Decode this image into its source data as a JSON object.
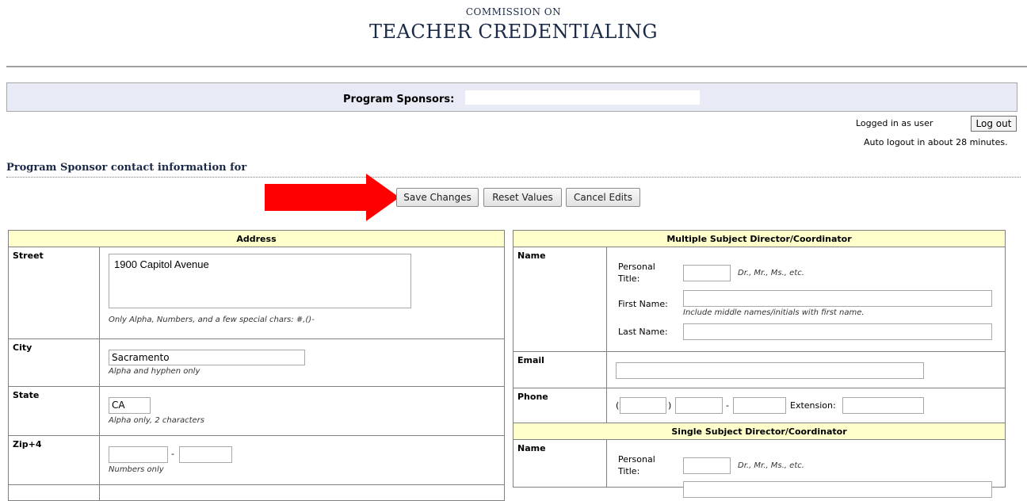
{
  "header": {
    "logo_line1": "COMMISSION ON",
    "logo_line2": "TEACHER CREDENTIALING"
  },
  "sponsor_bar": {
    "label": "Program Sponsors:",
    "value": ""
  },
  "session": {
    "logged_in": "Logged in as user",
    "logout": "Log out",
    "auto_logout": "Auto logout in about 28 minutes."
  },
  "section_title": "Program Sponsor contact information for",
  "actions": {
    "save": "Save Changes",
    "reset": "Reset Values",
    "cancel": "Cancel Edits"
  },
  "address": {
    "header": "Address",
    "street_label": "Street",
    "street_value": "1900 Capitol Avenue",
    "street_hint": "Only Alpha, Numbers, and a few special chars: #,()-",
    "city_label": "City",
    "city_value": "Sacramento",
    "city_hint": "Alpha and hyphen only",
    "state_label": "State",
    "state_value": "CA",
    "state_hint": "Alpha only, 2 characters",
    "zip_label": "Zip+4",
    "zip_dash": "-",
    "zip_hint": "Numbers only"
  },
  "multiple_subject": {
    "header": "Multiple Subject Director/Coordinator",
    "name_label": "Name",
    "personal_title": "Personal Title:",
    "title_hint": "Dr., Mr., Ms., etc.",
    "first_name": "First Name:",
    "first_hint": "Include middle names/initials with first name.",
    "last_name": "Last Name:",
    "email_label": "Email",
    "phone_label": "Phone",
    "paren_open": "(",
    "paren_close": ")",
    "dash": "-",
    "extension": "Extension:"
  },
  "single_subject": {
    "header": "Single Subject Director/Coordinator",
    "name_label": "Name",
    "personal_title": "Personal Title:",
    "title_hint": "Dr., Mr., Ms., etc."
  },
  "colors": {
    "header_fill": "#ffffcc",
    "sponsor_bar": "#e8ebf5",
    "arrow": "#ff0000"
  }
}
